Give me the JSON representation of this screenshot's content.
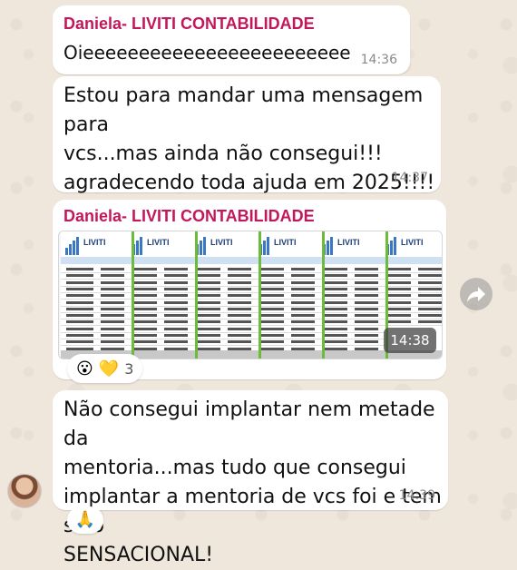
{
  "chat": {
    "messages": [
      {
        "sender": "Daniela- LIVITI CONTABILIDADE",
        "text": "Oieeeeeeeeeeeeeeeeeeeeeeee",
        "time": "14:36"
      },
      {
        "text_lines": [
          "Estou para mandar uma mensagem para",
          "vcs...mas ainda não consegui!!!",
          "agradecendo toda ajuda em 2025!!!!🙏",
          "🙏🙏🙏🙏"
        ],
        "time": "14:37"
      },
      {
        "sender": "Daniela- LIVITI CONTABILIDADE",
        "image_time": "14:38",
        "image_brand": "LIVITI",
        "reactions": {
          "emojis": [
            "😮",
            "💛"
          ],
          "count": "3"
        }
      },
      {
        "text_lines": [
          "Não consegui implantar nem metade da",
          "mentoria...mas tudo que consegui",
          "implantar a mentoria de vcs foi e tem sido",
          "SENSACIONAL!"
        ],
        "time": "14:39",
        "reaction": "🙏"
      }
    ]
  },
  "icons": {
    "forward": "forward-arrow-icon",
    "avatar": "contact-avatar"
  },
  "colors": {
    "sender_name": "#c2185b",
    "wallpaper": "#efe7dc",
    "bubble": "#ffffff",
    "timestamp": "#8a8a8a",
    "sheet_accent": "#6dbb3a"
  }
}
